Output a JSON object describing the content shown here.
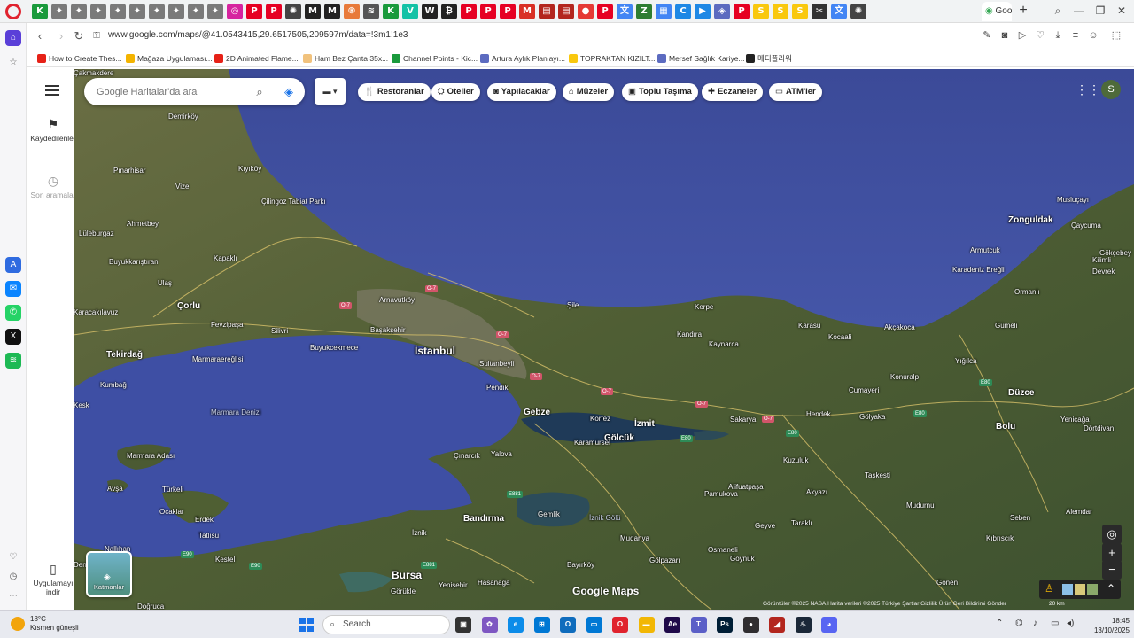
{
  "browser": {
    "active_tab_label": "Goo",
    "url": "www.google.com/maps/@41.0543415,29.6517505,209597m/data=!3m1!1e3",
    "tab_icons": [
      {
        "icon": "k-icon",
        "color": "#1a9a3c",
        "glyph": "K"
      },
      {
        "icon": "sparkle-icon",
        "color": "#7a7a7a",
        "glyph": "✦"
      },
      {
        "icon": "sparkle-icon",
        "color": "#7a7a7a",
        "glyph": "✦"
      },
      {
        "icon": "sparkle-icon",
        "color": "#7a7a7a",
        "glyph": "✦"
      },
      {
        "icon": "sparkle-icon",
        "color": "#7a7a7a",
        "glyph": "✦"
      },
      {
        "icon": "sparkle-icon",
        "color": "#7a7a7a",
        "glyph": "✦"
      },
      {
        "icon": "sparkle-icon",
        "color": "#7a7a7a",
        "glyph": "✦"
      },
      {
        "icon": "sparkle-icon",
        "color": "#7a7a7a",
        "glyph": "✦"
      },
      {
        "icon": "sparkle-icon",
        "color": "#7a7a7a",
        "glyph": "✦"
      },
      {
        "icon": "sparkle-icon",
        "color": "#7a7a7a",
        "glyph": "✦"
      },
      {
        "icon": "instagram-icon",
        "color": "#d6249f",
        "glyph": "◎"
      },
      {
        "icon": "pinterest-icon",
        "color": "#e60023",
        "glyph": "P"
      },
      {
        "icon": "pinterest-icon",
        "color": "#e60023",
        "glyph": "P"
      },
      {
        "icon": "chatgpt-icon",
        "color": "#444444",
        "glyph": "✺"
      },
      {
        "icon": "m-icon",
        "color": "#222222",
        "glyph": "M"
      },
      {
        "icon": "m-icon",
        "color": "#222222",
        "glyph": "M"
      },
      {
        "icon": "r-icon",
        "color": "#e87a3a",
        "glyph": "®"
      },
      {
        "icon": "m-icon",
        "color": "#555555",
        "glyph": "≋"
      },
      {
        "icon": "k-icon",
        "color": "#1a9a3c",
        "glyph": "K"
      },
      {
        "icon": "v-icon",
        "color": "#13c2a6",
        "glyph": "V"
      },
      {
        "icon": "w-icon",
        "color": "#222222",
        "glyph": "W"
      },
      {
        "icon": "x-icon",
        "color": "#222222",
        "glyph": "₿"
      },
      {
        "icon": "pinterest-icon",
        "color": "#e60023",
        "glyph": "P"
      },
      {
        "icon": "pinterest-icon",
        "color": "#e60023",
        "glyph": "P"
      },
      {
        "icon": "pinterest-icon",
        "color": "#e60023",
        "glyph": "P"
      },
      {
        "icon": "gmail-icon",
        "color": "#d93025",
        "glyph": "M"
      },
      {
        "icon": "film-icon",
        "color": "#b3261e",
        "glyph": "▤"
      },
      {
        "icon": "film-icon",
        "color": "#b3261e",
        "glyph": "▤"
      },
      {
        "icon": "record-icon",
        "color": "#e53935",
        "glyph": "●"
      },
      {
        "icon": "pinterest-icon",
        "color": "#e60023",
        "glyph": "P"
      },
      {
        "icon": "translate-icon",
        "color": "#4285f4",
        "glyph": "文"
      },
      {
        "icon": "leaf-icon",
        "color": "#2e7d32",
        "glyph": "Z"
      },
      {
        "icon": "docs-icon",
        "color": "#4285f4",
        "glyph": "▦"
      },
      {
        "icon": "c-icon",
        "color": "#1e88e5",
        "glyph": "C"
      },
      {
        "icon": "video-icon",
        "color": "#1e88e5",
        "glyph": "▶"
      },
      {
        "icon": "shield-icon",
        "color": "#5c6bc0",
        "glyph": "◈"
      },
      {
        "icon": "pinterest-icon",
        "color": "#e60023",
        "glyph": "P"
      },
      {
        "icon": "s-icon",
        "color": "#f9c80e",
        "glyph": "S"
      },
      {
        "icon": "s-icon",
        "color": "#f9c80e",
        "glyph": "S"
      },
      {
        "icon": "s-icon",
        "color": "#f9c80e",
        "glyph": "S"
      },
      {
        "icon": "scissors-icon",
        "color": "#333333",
        "glyph": "✂"
      },
      {
        "icon": "translate-icon",
        "color": "#4285f4",
        "glyph": "文"
      },
      {
        "icon": "chatgpt-icon",
        "color": "#444444",
        "glyph": "✺"
      }
    ],
    "bookmarks": [
      {
        "label": "How to Create Thes...",
        "color": "#e62117"
      },
      {
        "label": "Mağaza Uygulaması...",
        "color": "#f4b400"
      },
      {
        "label": "2D Animated Flame...",
        "color": "#e62117"
      },
      {
        "label": "Ham Bez Çanta 35x...",
        "color": "#f1c27d"
      },
      {
        "label": "Channel Points - Kic...",
        "color": "#1a9a3c"
      },
      {
        "label": "Artura Aylık Planlayı...",
        "color": "#5c6bc0"
      },
      {
        "label": "TOPRAKTAN KIZILT...",
        "color": "#f9c80e"
      },
      {
        "label": "Mersef Sağlık Kariye...",
        "color": "#5c6bc0"
      },
      {
        "label": "메디플라워",
        "color": "#222222"
      }
    ]
  },
  "maps": {
    "rail": {
      "saved_label": "Kaydedilenler",
      "recent_label": "Son aramalar",
      "app_label": "Uygulamayı indir"
    },
    "search_placeholder": "Google Haritalar'da ara",
    "chips": [
      {
        "label": "Restoranlar",
        "icon": "fork-knife-icon",
        "glyph": "🍴"
      },
      {
        "label": "Oteller",
        "icon": "bed-icon",
        "glyph": "⛭"
      },
      {
        "label": "Yapılacaklar",
        "icon": "camera-icon",
        "glyph": "◙"
      },
      {
        "label": "Müzeler",
        "icon": "museum-icon",
        "glyph": "⌂"
      },
      {
        "label": "Toplu Taşıma",
        "icon": "bus-icon",
        "glyph": "▣"
      },
      {
        "label": "Eczaneler",
        "icon": "pharmacy-icon",
        "glyph": "✚"
      },
      {
        "label": "ATM'ler",
        "icon": "atm-icon",
        "glyph": "▭"
      }
    ],
    "avatar_letter": "S",
    "layers_label": "Katmanlar",
    "logo": "Google Maps",
    "attribution": "Görüntüler ©2025 NASA,Harita verileri ©2025   Türkiye   Şartlar   Gizlilik   Ürün Geri Bildirimi Gönder",
    "scale": "20 km",
    "places": [
      {
        "name": "Demirköy",
        "cls": ""
      },
      {
        "name": "Pınarhisar",
        "cls": ""
      },
      {
        "name": "Vize",
        "cls": ""
      },
      {
        "name": "Kıyıköy",
        "cls": ""
      },
      {
        "name": "Çilingoz Tabiat Parkı",
        "cls": ""
      },
      {
        "name": "Ahmetbey",
        "cls": ""
      },
      {
        "name": "Lüleburgaz",
        "cls": ""
      },
      {
        "name": "Buyukkarıştıran",
        "cls": ""
      },
      {
        "name": "Kapaklı",
        "cls": ""
      },
      {
        "name": "Ulaş",
        "cls": ""
      },
      {
        "name": "Çorlu",
        "cls": "mid"
      },
      {
        "name": "Karacakılavuz",
        "cls": ""
      },
      {
        "name": "Fevzipaşa",
        "cls": ""
      },
      {
        "name": "Silivri",
        "cls": ""
      },
      {
        "name": "Tekirdağ",
        "cls": "mid"
      },
      {
        "name": "Marmaraereğlisi",
        "cls": ""
      },
      {
        "name": "Kumbağ",
        "cls": ""
      },
      {
        "name": "Arnavutköy",
        "cls": ""
      },
      {
        "name": "Başakşehir",
        "cls": ""
      },
      {
        "name": "Buyukcekmece",
        "cls": ""
      },
      {
        "name": "İstanbul",
        "cls": "big"
      },
      {
        "name": "Sultanbeyli",
        "cls": ""
      },
      {
        "name": "Pendik",
        "cls": ""
      },
      {
        "name": "Şile",
        "cls": ""
      },
      {
        "name": "Kerpe",
        "cls": ""
      },
      {
        "name": "Kandıra",
        "cls": ""
      },
      {
        "name": "Kaynarca",
        "cls": ""
      },
      {
        "name": "Karasu",
        "cls": ""
      },
      {
        "name": "Kocaali",
        "cls": ""
      },
      {
        "name": "Akçakoca",
        "cls": ""
      },
      {
        "name": "Zonguldak",
        "cls": "mid"
      },
      {
        "name": "Musluçayı",
        "cls": ""
      },
      {
        "name": "Çaycuma",
        "cls": ""
      },
      {
        "name": "Armutcuk",
        "cls": ""
      },
      {
        "name": "Karadeniz Ereğli",
        "cls": ""
      },
      {
        "name": "Kilimli",
        "cls": ""
      },
      {
        "name": "Gökçebey",
        "cls": ""
      },
      {
        "name": "Devrek",
        "cls": ""
      },
      {
        "name": "Ormanlı",
        "cls": ""
      },
      {
        "name": "Gümeli",
        "cls": ""
      },
      {
        "name": "Yığılca",
        "cls": ""
      },
      {
        "name": "Cumayeri",
        "cls": ""
      },
      {
        "name": "Konuralp",
        "cls": ""
      },
      {
        "name": "Düzce",
        "cls": "mid"
      },
      {
        "name": "Hendek",
        "cls": ""
      },
      {
        "name": "Gölyaka",
        "cls": ""
      },
      {
        "name": "Bolu",
        "cls": "mid"
      },
      {
        "name": "Yeniçağa",
        "cls": ""
      },
      {
        "name": "Dörtdivan",
        "cls": ""
      },
      {
        "name": "Gebze",
        "cls": "mid"
      },
      {
        "name": "Körfez",
        "cls": ""
      },
      {
        "name": "İzmit",
        "cls": "mid"
      },
      {
        "name": "Gölcük",
        "cls": "mid"
      },
      {
        "name": "Karamürsel",
        "cls": ""
      },
      {
        "name": "Sakarya",
        "cls": ""
      },
      {
        "name": "Kuzuluk",
        "cls": ""
      },
      {
        "name": "Taşkesti",
        "cls": ""
      },
      {
        "name": "Akyazı",
        "cls": ""
      },
      {
        "name": "Çınarcık",
        "cls": ""
      },
      {
        "name": "Yalova",
        "cls": ""
      },
      {
        "name": "Alifuatpaşa",
        "cls": ""
      },
      {
        "name": "Pamukova",
        "cls": ""
      },
      {
        "name": "Mudurnu",
        "cls": ""
      },
      {
        "name": "Seben",
        "cls": ""
      },
      {
        "name": "Kıbrıscık",
        "cls": ""
      },
      {
        "name": "Alemdar",
        "cls": ""
      },
      {
        "name": "Marmara Denizi",
        "cls": "sea"
      },
      {
        "name": "Marmara Adası",
        "cls": ""
      },
      {
        "name": "Avşa",
        "cls": ""
      },
      {
        "name": "Türkeli",
        "cls": ""
      },
      {
        "name": "Ocaklar",
        "cls": ""
      },
      {
        "name": "Erdek",
        "cls": ""
      },
      {
        "name": "Tatlısu",
        "cls": ""
      },
      {
        "name": "Bandırma",
        "cls": "mid"
      },
      {
        "name": "Gemlik",
        "cls": ""
      },
      {
        "name": "İznik Gölü",
        "cls": "sea"
      },
      {
        "name": "İznik",
        "cls": ""
      },
      {
        "name": "Mudanya",
        "cls": ""
      },
      {
        "name": "Osmaneli",
        "cls": ""
      },
      {
        "name": "Geyve",
        "cls": ""
      },
      {
        "name": "Taraklı",
        "cls": ""
      },
      {
        "name": "Göynük",
        "cls": ""
      },
      {
        "name": "Gölpazarı",
        "cls": ""
      },
      {
        "name": "Bayırköy",
        "cls": ""
      },
      {
        "name": "Yenişehir",
        "cls": ""
      },
      {
        "name": "Bursa",
        "cls": "big"
      },
      {
        "name": "Görükle",
        "cls": ""
      },
      {
        "name": "Hasanağa",
        "cls": ""
      },
      {
        "name": "Kestel",
        "cls": ""
      },
      {
        "name": "Doğruca",
        "cls": ""
      },
      {
        "name": "Gönen",
        "cls": ""
      },
      {
        "name": "Nallıhan",
        "cls": ""
      },
      {
        "name": "Denizkent",
        "cls": ""
      },
      {
        "name": "Kesk",
        "cls": ""
      },
      {
        "name": "Çakmakdere",
        "cls": ""
      }
    ],
    "roads": [
      {
        "label": "O-7",
        "cls": ""
      },
      {
        "label": "O-7",
        "cls": ""
      },
      {
        "label": "O-7",
        "cls": ""
      },
      {
        "label": "O-7",
        "cls": ""
      },
      {
        "label": "O-7",
        "cls": ""
      },
      {
        "label": "O-7",
        "cls": ""
      },
      {
        "label": "O-7",
        "cls": ""
      },
      {
        "label": "E80",
        "cls": "green"
      },
      {
        "label": "E80",
        "cls": "green"
      },
      {
        "label": "E80",
        "cls": "green"
      },
      {
        "label": "E881",
        "cls": "green"
      },
      {
        "label": "E881",
        "cls": "green"
      },
      {
        "label": "E90",
        "cls": "green"
      },
      {
        "label": "E90",
        "cls": "green"
      },
      {
        "label": "E80",
        "cls": "green"
      }
    ]
  },
  "taskbar": {
    "temp": "18°C",
    "weather": "Kısmen güneşli",
    "search": "Search",
    "time": "18:45",
    "date": "13/10/2025",
    "apps": [
      {
        "icon": "task-view-icon",
        "color": "#333333",
        "glyph": "▣"
      },
      {
        "icon": "copilot-icon",
        "color": "#7e57c2",
        "glyph": "✿"
      },
      {
        "icon": "edge-icon",
        "color": "#0c8ce9",
        "glyph": "e"
      },
      {
        "icon": "store-icon",
        "color": "#0078d4",
        "glyph": "⊞"
      },
      {
        "icon": "outlook-icon",
        "color": "#0f6cbd",
        "glyph": "O"
      },
      {
        "icon": "monitor-icon",
        "color": "#0078d4",
        "glyph": "▭"
      },
      {
        "icon": "opera-icon",
        "color": "#e0232e",
        "glyph": "O"
      },
      {
        "icon": "folder-icon",
        "color": "#f2b705",
        "glyph": "▬"
      },
      {
        "icon": "after-effects-icon",
        "color": "#1f0a4a",
        "glyph": "Ae"
      },
      {
        "icon": "teams-icon",
        "color": "#5b5fc7",
        "glyph": "T"
      },
      {
        "icon": "photoshop-icon",
        "color": "#001e36",
        "glyph": "Ps"
      },
      {
        "icon": "obs-icon",
        "color": "#302e31",
        "glyph": "●"
      },
      {
        "icon": "dp-icon",
        "color": "#b3261e",
        "glyph": "◢"
      },
      {
        "icon": "steam-icon",
        "color": "#1b2838",
        "glyph": "♨"
      },
      {
        "icon": "discord-icon",
        "color": "#5865f2",
        "glyph": "◕"
      }
    ]
  }
}
